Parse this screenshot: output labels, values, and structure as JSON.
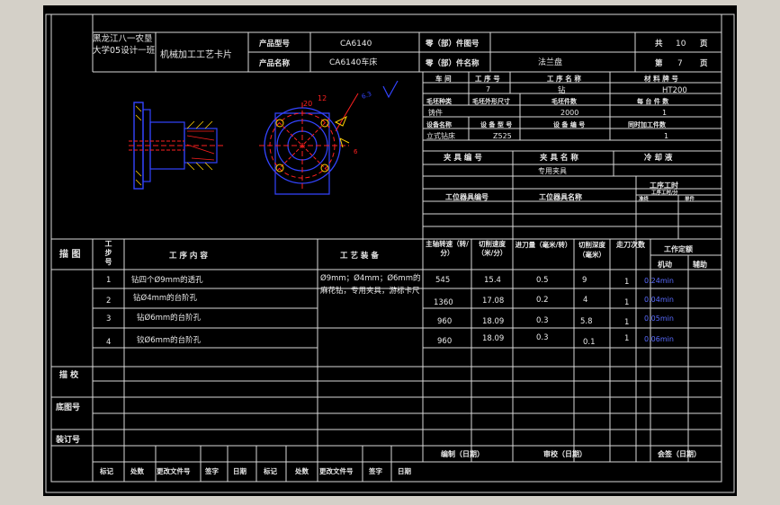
{
  "header": {
    "school": "黑龙江八一农垦大学05设计一班",
    "card_title": "机械加工工艺卡片",
    "product_model_label": "产品型号",
    "product_model": "CA6140",
    "product_name_label": "产品名称",
    "product_name": "CA6140车床",
    "part_no_label": "零（部）件图号",
    "part_no": "",
    "part_name_label": "零（部）件名称",
    "part_name": "法兰盘",
    "total_label": "共",
    "total_pages": "10",
    "page_unit": "页",
    "page_label": "第",
    "page_no": "7",
    "page_unit2": "页"
  },
  "info": {
    "r1": [
      "车  间",
      "工 序 号",
      "工 序 名 称",
      "材 料 牌 号"
    ],
    "r2": [
      "",
      "7",
      "钻",
      "HT200"
    ],
    "r3": [
      "毛坯种类",
      "毛坯外形尺寸",
      "毛坯件数",
      "每 台 件 数"
    ],
    "r4": [
      "铸件",
      "",
      "2000",
      "1"
    ],
    "r5": [
      "设备名称",
      "设 备 型 号",
      "设 备 编 号",
      "同时加工件数"
    ],
    "r6": [
      "立式钻床",
      "Z525",
      "",
      "1"
    ],
    "r7": [
      "夹 具 编 号",
      "夹 具 名 称",
      "冷 却 液"
    ],
    "fixture_name": "专用夹具",
    "workstation_label": "工位器具编号",
    "workstation_name_label": "工位器具名称",
    "time_quota": "工序工时",
    "time_quota2": "工序工时/分",
    "prep": "准终",
    "single": "单件"
  },
  "drawing": {
    "dim_a": "20",
    "dim_b": "12",
    "dim_c": "6",
    "roughness": "6.3"
  },
  "table": {
    "col_sketch": "描 图",
    "col_step": "工步号",
    "col_content": "工 序 内 容",
    "col_equipment": "工 艺 装 备",
    "col_speed": "主轴转速（转/分）",
    "col_cut": "切削速度（米/分）",
    "col_feed": "进刀量（毫米/转）",
    "col_depth": "切削深度（毫米）",
    "col_pass": "走刀次数",
    "col_time": "工作定额",
    "col_machine": "机动",
    "col_aux": "辅助",
    "equipment_text": "Ø9mm；Ø4mm；Ø6mm的麻花钻，专用夹具，游标卡尺",
    "rows": [
      {
        "step": "1",
        "content": "钻四个Ø9mm的透孔",
        "speed": "545",
        "cut": "15.4",
        "feed": "0.5",
        "depth": "9",
        "pass": "1",
        "time": "0.24min"
      },
      {
        "step": "2",
        "content": "钻Ø4mm的台阶孔",
        "speed": "1360",
        "cut": "17.08",
        "feed": "0.2",
        "depth": "4",
        "pass": "1",
        "time": "0.04min"
      },
      {
        "step": "3",
        "content": "钻Ø6mm的台阶孔",
        "speed": "960",
        "cut": "18.09",
        "feed": "0.3",
        "depth": "5.8",
        "pass": "1",
        "time": "0.05min"
      },
      {
        "step": "4",
        "content": "铰Ø6mm的台阶孔",
        "speed": "960",
        "cut": "18.09",
        "feed": "0.3",
        "depth": "0.1",
        "pass": "1",
        "time": "0.06min"
      }
    ]
  },
  "footer": {
    "trace": "描 校",
    "bottom_fig": "底图号",
    "binding": "装订号",
    "compile": "编制（日期）",
    "review": "审校（日期）",
    "sign": "会签（日期）",
    "marks": [
      "标记",
      "处数",
      "更改文件号",
      "签字",
      "日期",
      "标记",
      "处数",
      "更改文件号",
      "签字",
      "日期"
    ]
  },
  "colors": {
    "sheet": "#000000",
    "line": "#d8d8d8",
    "drawing_blue": "#3344ff",
    "drawing_red": "#ff2020",
    "drawing_yellow": "#ffd000"
  }
}
